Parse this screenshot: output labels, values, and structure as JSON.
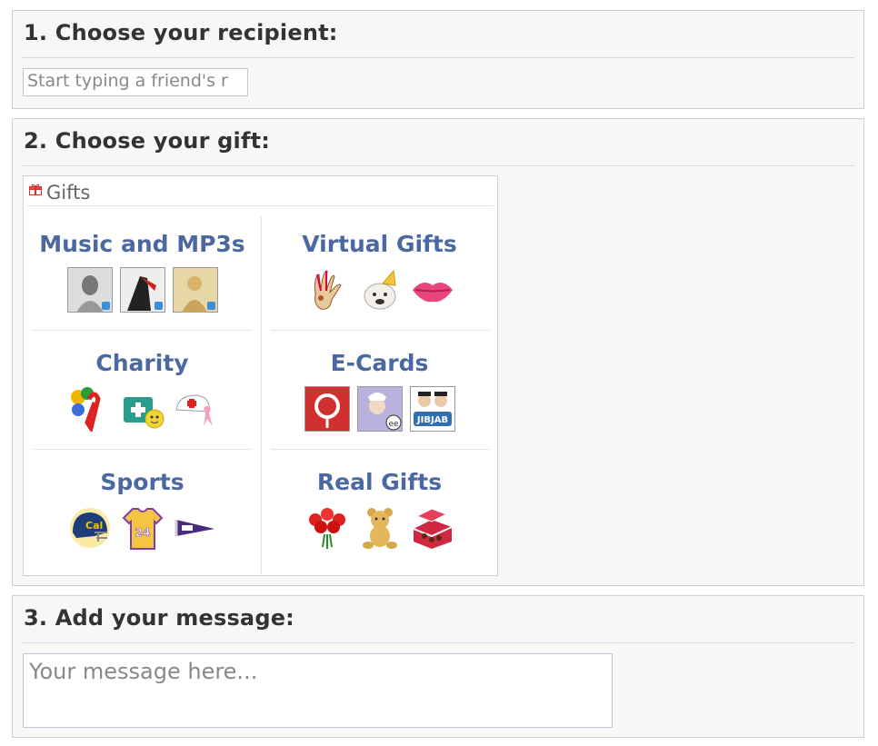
{
  "step1": {
    "title": "1. Choose your recipient:",
    "recipient_placeholder": "Start typing a friend's r"
  },
  "step2": {
    "title": "2. Choose your gift:",
    "gifts_header": "Gifts",
    "categories": [
      {
        "label": "Music and MP3s",
        "icons": [
          "album-cover-icon",
          "album-cover-icon",
          "album-cover-icon"
        ]
      },
      {
        "label": "Virtual Gifts",
        "icons": [
          "turkey-hand-icon",
          "party-dog-icon",
          "lips-kiss-icon"
        ]
      },
      {
        "label": "Charity",
        "icons": [
          "ribbon-balloons-icon",
          "first-aid-kit-icon",
          "nurse-cap-icon"
        ]
      },
      {
        "label": "E-Cards",
        "icons": [
          "rose-card-icon",
          "chef-card-icon",
          "jibjab-card-icon"
        ]
      },
      {
        "label": "Sports",
        "icons": [
          "football-helmet-icon",
          "jersey-icon",
          "pennant-icon"
        ]
      },
      {
        "label": "Real Gifts",
        "icons": [
          "roses-bouquet-icon",
          "teddy-bear-icon",
          "chocolate-box-icon"
        ]
      }
    ]
  },
  "step3": {
    "title": "3. Add your message:",
    "message_placeholder": "Your message here..."
  }
}
